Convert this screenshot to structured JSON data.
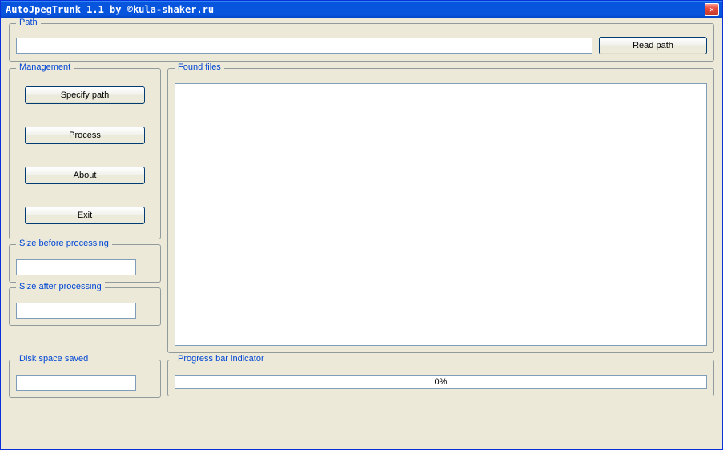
{
  "window": {
    "title": "AutoJpegTrunk 1.1 by ©kula-shaker.ru"
  },
  "path": {
    "legend": "Path",
    "value": "",
    "read_button": "Read path"
  },
  "management": {
    "legend": "Management",
    "specify_path": "Specify path",
    "process": "Process",
    "about": "About",
    "exit": "Exit"
  },
  "found_files": {
    "legend": "Found files"
  },
  "size_before": {
    "legend": "Size before processing",
    "value": ""
  },
  "size_after": {
    "legend": "Size after processing",
    "value": ""
  },
  "disk_saved": {
    "legend": "Disk space saved",
    "value": ""
  },
  "progress": {
    "legend": "Progress bar indicator",
    "text": "0%"
  }
}
